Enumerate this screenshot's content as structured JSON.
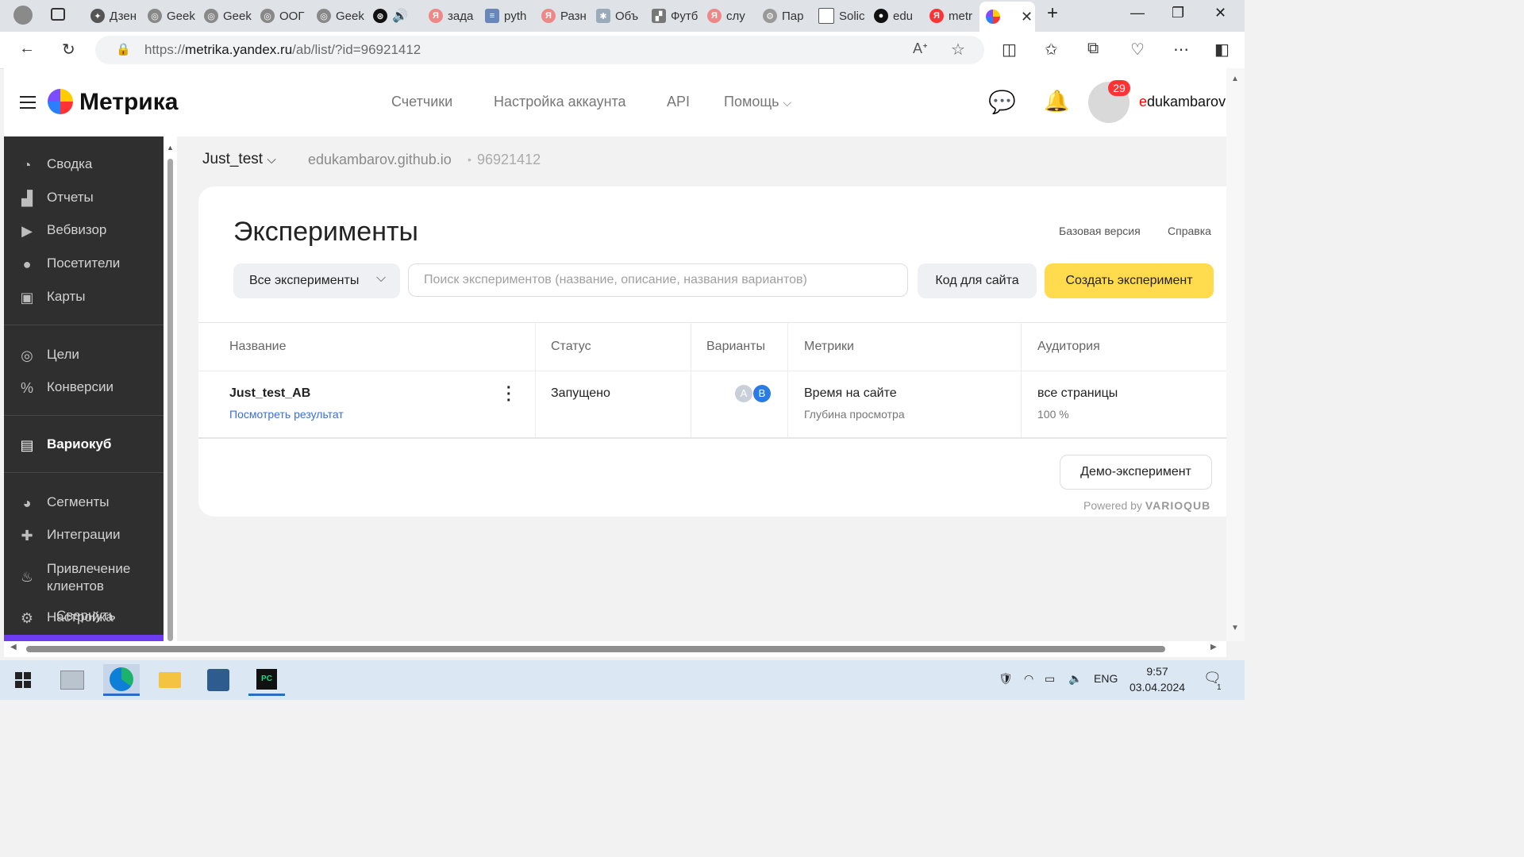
{
  "browser": {
    "tabs": [
      {
        "label": "Дзен"
      },
      {
        "label": "Geek"
      },
      {
        "label": "Geek"
      },
      {
        "label": "ООГ"
      },
      {
        "label": "Geek"
      },
      {
        "label": ""
      },
      {
        "label": "зада"
      },
      {
        "label": "pyth"
      },
      {
        "label": "Разн"
      },
      {
        "label": "Объ"
      },
      {
        "label": "Футб"
      },
      {
        "label": "слу"
      },
      {
        "label": "Пар"
      },
      {
        "label": "Solic"
      },
      {
        "label": "edu"
      },
      {
        "label": "metr"
      },
      {
        "label": ""
      }
    ],
    "url_prefix": "https://",
    "url_host": "metrika.yandex.ru",
    "url_path": "/ab/list/?id=96921412"
  },
  "header": {
    "logo": "Метрика",
    "nav": [
      "Счетчики",
      "Настройка аккаунта",
      "API",
      "Помощь"
    ],
    "notification_count": "29",
    "username_first": "e",
    "username_rest": "dukambarov"
  },
  "sidebar": {
    "items": [
      {
        "label": "Сводка",
        "icon": "gauge-icon"
      },
      {
        "label": "Отчеты",
        "icon": "bar-chart-icon"
      },
      {
        "label": "Вебвизор",
        "icon": "play-icon"
      },
      {
        "label": "Посетители",
        "icon": "person-icon"
      },
      {
        "label": "Карты",
        "icon": "map-icon"
      },
      {
        "label": "Цели",
        "icon": "target-icon"
      },
      {
        "label": "Конверсии",
        "icon": "percent-icon"
      },
      {
        "label": "Вариокуб",
        "icon": "variocube-icon"
      },
      {
        "label": "Сегменты",
        "icon": "pie-icon"
      },
      {
        "label": "Интеграции",
        "icon": "puzzle-icon"
      },
      {
        "label": "Привлечение клиентов",
        "icon": "fire-icon"
      },
      {
        "label": "Настройка",
        "icon": "gear-icon"
      }
    ],
    "collapse_label": "Свернуть"
  },
  "counter": {
    "name": "Just_test",
    "site": "edukambarov.github.io",
    "separator": "•",
    "id": "96921412"
  },
  "page": {
    "title": "Эксперименты",
    "links": [
      "Базовая версия",
      "Справка"
    ],
    "filter": "Все эксперименты",
    "search_placeholder": "Поиск экспериментов (название, описание, названия вариантов)",
    "code_button": "Код для сайта",
    "create_button": "Создать эксперимент",
    "columns": [
      "Название",
      "Статус",
      "Варианты",
      "Метрики",
      "Аудитория"
    ],
    "rows": [
      {
        "name": "Just_test_AB",
        "result_link": "Посмотреть результат",
        "status": "Запущено",
        "variants": [
          "A",
          "B"
        ],
        "metric_main": "Время на сайте",
        "metric_sub": "Глубина просмотра",
        "audience": "все страницы",
        "audience_share": "100 %"
      }
    ],
    "demo_button": "Демо-эксперимент",
    "powered_by": "Powered by",
    "powered_brand": "VARIOQUB"
  },
  "taskbar": {
    "lang": "ENG",
    "time": "9:57",
    "date": "03.04.2024",
    "notif_count": "1"
  },
  "colors": {
    "accent_yellow": "#ffdb4d",
    "link_blue": "#3a6fd8",
    "badge_red": "#ff3333",
    "sidebar_bg": "#2f2f2f",
    "sidebar_accent": "#6d3cf0"
  }
}
